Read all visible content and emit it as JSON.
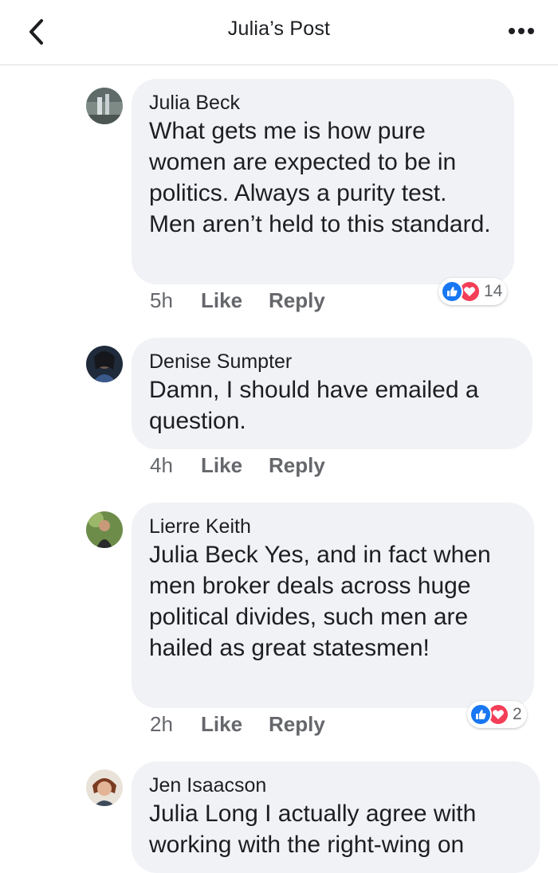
{
  "header": {
    "title": "Julia’s Post",
    "back_icon": "chevron-left-icon",
    "more_icon": "more-horizontal-icon"
  },
  "comments": [
    {
      "author": "Julia Beck",
      "mention": "",
      "text": "What gets me is how pure women are expected to be in politics. Always a purity test. Men aren’t held to this standard.",
      "time": "5h",
      "like": "Like",
      "reply": "Reply",
      "reaction_count": "14"
    },
    {
      "author": "Denise Sumpter",
      "mention": "",
      "text": "Damn, I should have emailed a question.",
      "time": "4h",
      "like": "Like",
      "reply": "Reply"
    },
    {
      "author": "Lierre Keith",
      "mention": "Julia Beck",
      "text": "Yes, and in fact when men broker deals across huge political divides, such men are hailed as great statesmen!",
      "time": "2h",
      "like": "Like",
      "reply": "Reply",
      "reaction_count": "2"
    },
    {
      "author": "Jen Isaacson",
      "mention": "Julia Long",
      "text": "I actually agree with working with the right-wing on"
    }
  ],
  "colors": {
    "bubble": "#f0f2f5",
    "like_blue": "#1877f2",
    "love_red": "#f33e58",
    "meta_gray": "#65676b"
  }
}
